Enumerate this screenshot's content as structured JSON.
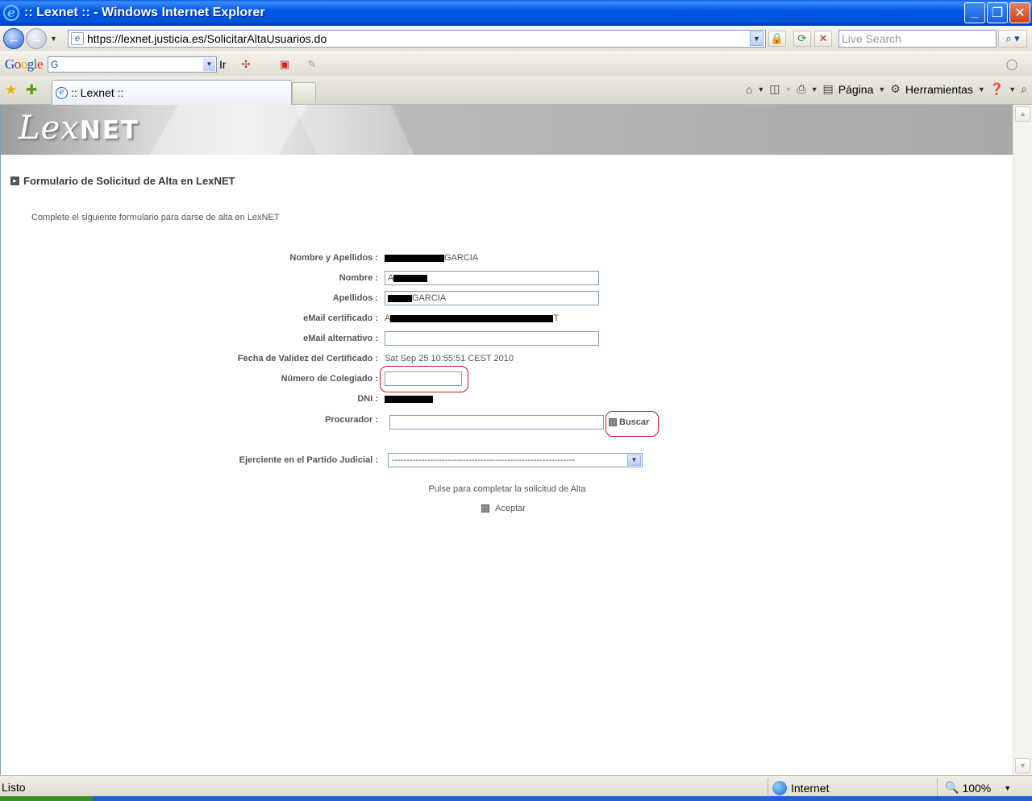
{
  "window": {
    "title": ":: Lexnet :: - Windows Internet Explorer",
    "icons": {
      "app": "ie-icon",
      "minimize": "minimize-icon",
      "maximize": "maximize-icon",
      "close": "close-icon"
    }
  },
  "addressbar": {
    "url": "https://lexnet.justicia.es/SolicitarAltaUsuarios.do",
    "search_placeholder": "Live Search"
  },
  "googlebar": {
    "logo": {
      "g1": "G",
      "o1": "o",
      "o2": "o",
      "g2": "g",
      "l": "l",
      "e": "e"
    },
    "search_value": "G",
    "go_label": "Ir"
  },
  "tabs": [
    {
      "label": ":: Lexnet ::"
    }
  ],
  "commandbar": {
    "page_label": "Página",
    "tools_label": "Herramientas"
  },
  "banner": {
    "logo_lex": "Lex",
    "logo_net": "NET"
  },
  "form": {
    "title": "Formulario de Solicitud de Alta en LexNET",
    "intro": "Complete el siguiente formulario para darse de alta en LexNET",
    "labels": {
      "nombre_apellidos": "Nombre y Apellidos :",
      "nombre": "Nombre :",
      "apellidos": "Apellidos :",
      "email_certificado": "eMail certificado :",
      "email_alternativo": "eMail alternativo :",
      "fecha_validez": "Fecha de Validez del Certificado :",
      "numero_colegiado": "Número de Colegiado :",
      "dni": "DNI :",
      "procurador": "Procurador :",
      "partido_judicial": "Ejerciente en el Partido Judicial :"
    },
    "values": {
      "nombre_apellidos_suffix": "GARCIA",
      "nombre_prefix": "A",
      "apellidos_suffix": "GARCIA",
      "email_prefix": "A",
      "email_suffix": "T",
      "email_alternativo": "",
      "fecha_validez": "Sat Sep 25 10:55:51 CEST 2010",
      "numero_colegiado": "",
      "procurador": ""
    },
    "partido_judicial_selected": "--------------------------------------------------------------",
    "buscar_label": "Buscar",
    "pulse_text": "Pulse para completar la solicitud de Alta",
    "aceptar_label": "Aceptar"
  },
  "status": {
    "text": "Listo",
    "zone": "Internet",
    "zoom": "100%"
  },
  "colors": {
    "titlebar": "#0058e6",
    "highlight": "#c2191c",
    "label_gray": "#555555"
  }
}
